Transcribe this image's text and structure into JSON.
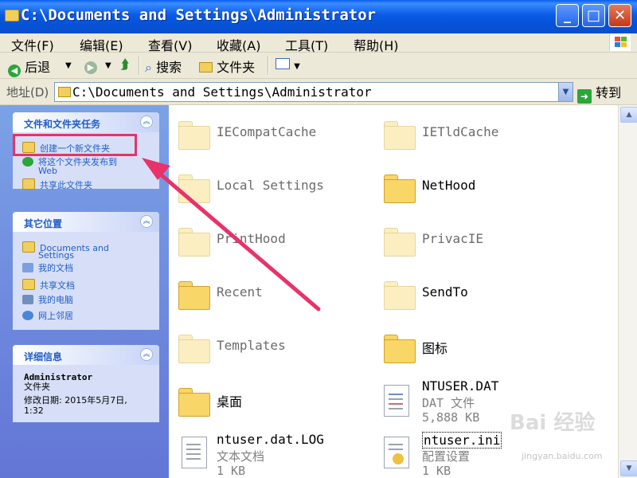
{
  "window": {
    "title": "C:\\Documents and Settings\\Administrator"
  },
  "menu": [
    "文件(F)",
    "编辑(E)",
    "查看(V)",
    "收藏(A)",
    "工具(T)",
    "帮助(H)"
  ],
  "toolbar": {
    "back": "后退",
    "search": "搜索",
    "folders": "文件夹"
  },
  "address": {
    "label": "地址(D)",
    "value": "C:\\Documents and Settings\\Administrator",
    "go": "转到"
  },
  "tasks_panel": {
    "title": "文件和文件夹任务",
    "items": [
      "创建一个新文件夹",
      "将这个文件夹发布到",
      "Web",
      "共享此文件夹"
    ]
  },
  "places_panel": {
    "title": "其它位置",
    "items": [
      "Documents and",
      "Settings",
      "我的文档",
      "共享文档",
      "我的电脑",
      "网上邻居"
    ]
  },
  "details_panel": {
    "title": "详细信息",
    "name": "Administrator",
    "type": "文件夹",
    "modified_line1": "修改日期: 2015年5月7日,",
    "modified_line2": "1:32"
  },
  "files": [
    {
      "name": "IECompatCache"
    },
    {
      "name": "IETldCache"
    },
    {
      "name": "Local Settings"
    },
    {
      "name": "NetHood"
    },
    {
      "name": "PrintHood"
    },
    {
      "name": "PrivacIE"
    },
    {
      "name": "Recent"
    },
    {
      "name": "SendTo"
    },
    {
      "name": "Templates"
    },
    {
      "name": "图标"
    },
    {
      "name": "桌面"
    },
    {
      "name": "NTUSER.DAT",
      "type": "DAT 文件",
      "size": "5,888 KB"
    },
    {
      "name": "ntuser.dat.LOG",
      "type": "文本文档",
      "size": "1 KB"
    },
    {
      "name": "ntuser.ini",
      "type": "配置设置",
      "size": "1 KB"
    }
  ],
  "watermark": {
    "brand": "Bai 经验",
    "url": "jingyan.baidu.com"
  },
  "colors": {
    "titlebar": "#0a5cf0",
    "panel_link": "#215dc6",
    "highlight": "#e8326a"
  }
}
